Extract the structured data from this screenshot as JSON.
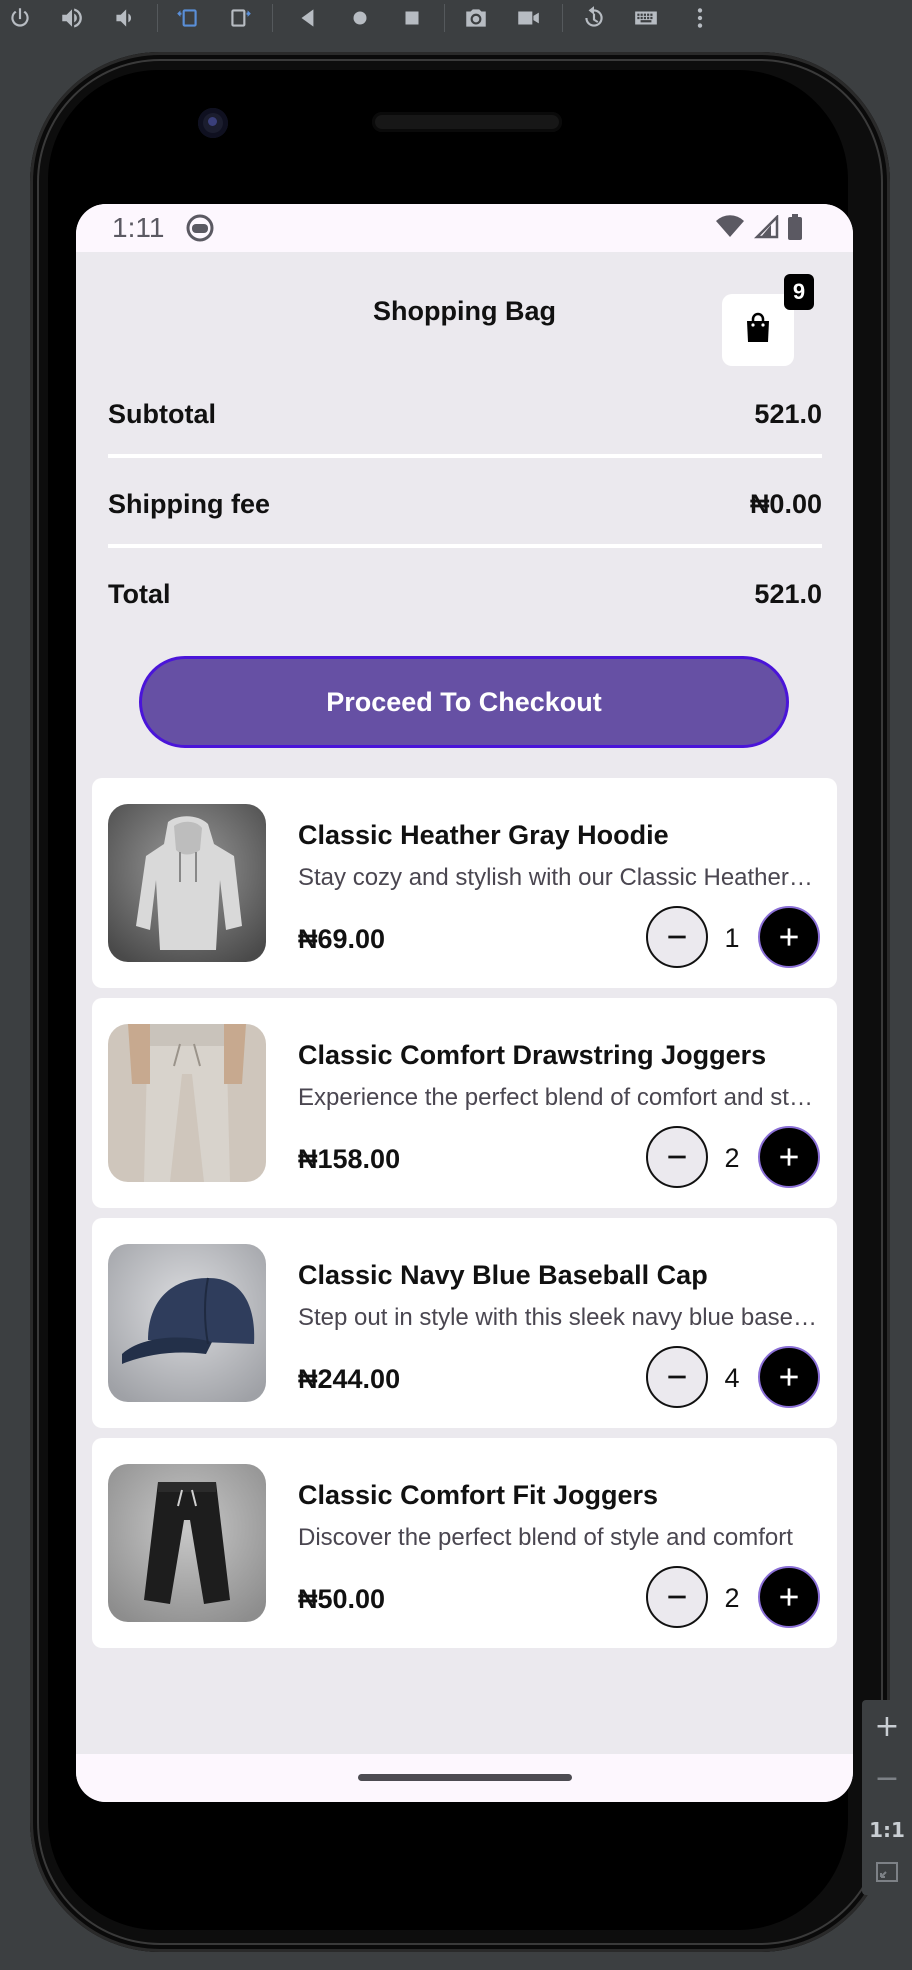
{
  "emulator": {
    "toolbar_icons": [
      "power-icon",
      "volume-up-icon",
      "volume-down-icon",
      "rotate-left-icon",
      "rotate-right-icon",
      "back-icon",
      "home-icon",
      "overview-icon",
      "camera-icon",
      "video-icon",
      "replay-icon",
      "keyboard-icon",
      "more-icon"
    ],
    "zoom_in": "+",
    "zoom_out": "−",
    "zoom_ratio": "1:1"
  },
  "status_bar": {
    "time": "1:11"
  },
  "header": {
    "title": "Shopping Bag",
    "bag_badge": "9"
  },
  "summary": {
    "subtotal_label": "Subtotal",
    "subtotal_value": "521.0",
    "shipping_label": "Shipping fee",
    "shipping_value": "₦0.00",
    "total_label": "Total",
    "total_value": "521.0"
  },
  "checkout_button": "Proceed To Checkout",
  "cart_items": [
    {
      "title": "Classic Heather Gray Hoodie",
      "description": "Stay cozy and stylish with our Classic Heather Gray Hoodie",
      "price": "₦69.00",
      "quantity": "1"
    },
    {
      "title": "Classic Comfort Drawstring Joggers",
      "description": "Experience the perfect blend of comfort and style",
      "price": "₦158.00",
      "quantity": "2"
    },
    {
      "title": "Classic Navy Blue Baseball Cap",
      "description": "Step out in style with this sleek navy blue baseball cap",
      "price": "₦244.00",
      "quantity": "4"
    },
    {
      "title": "Classic Comfort Fit Joggers",
      "description": "Discover the perfect blend of style and comfort",
      "price": "₦50.00",
      "quantity": "2"
    }
  ],
  "colors": {
    "accent": "#6650a4",
    "accent_border": "#4a14d9",
    "screen_background": "#ebe9ee",
    "card_background": "#ffffff"
  }
}
